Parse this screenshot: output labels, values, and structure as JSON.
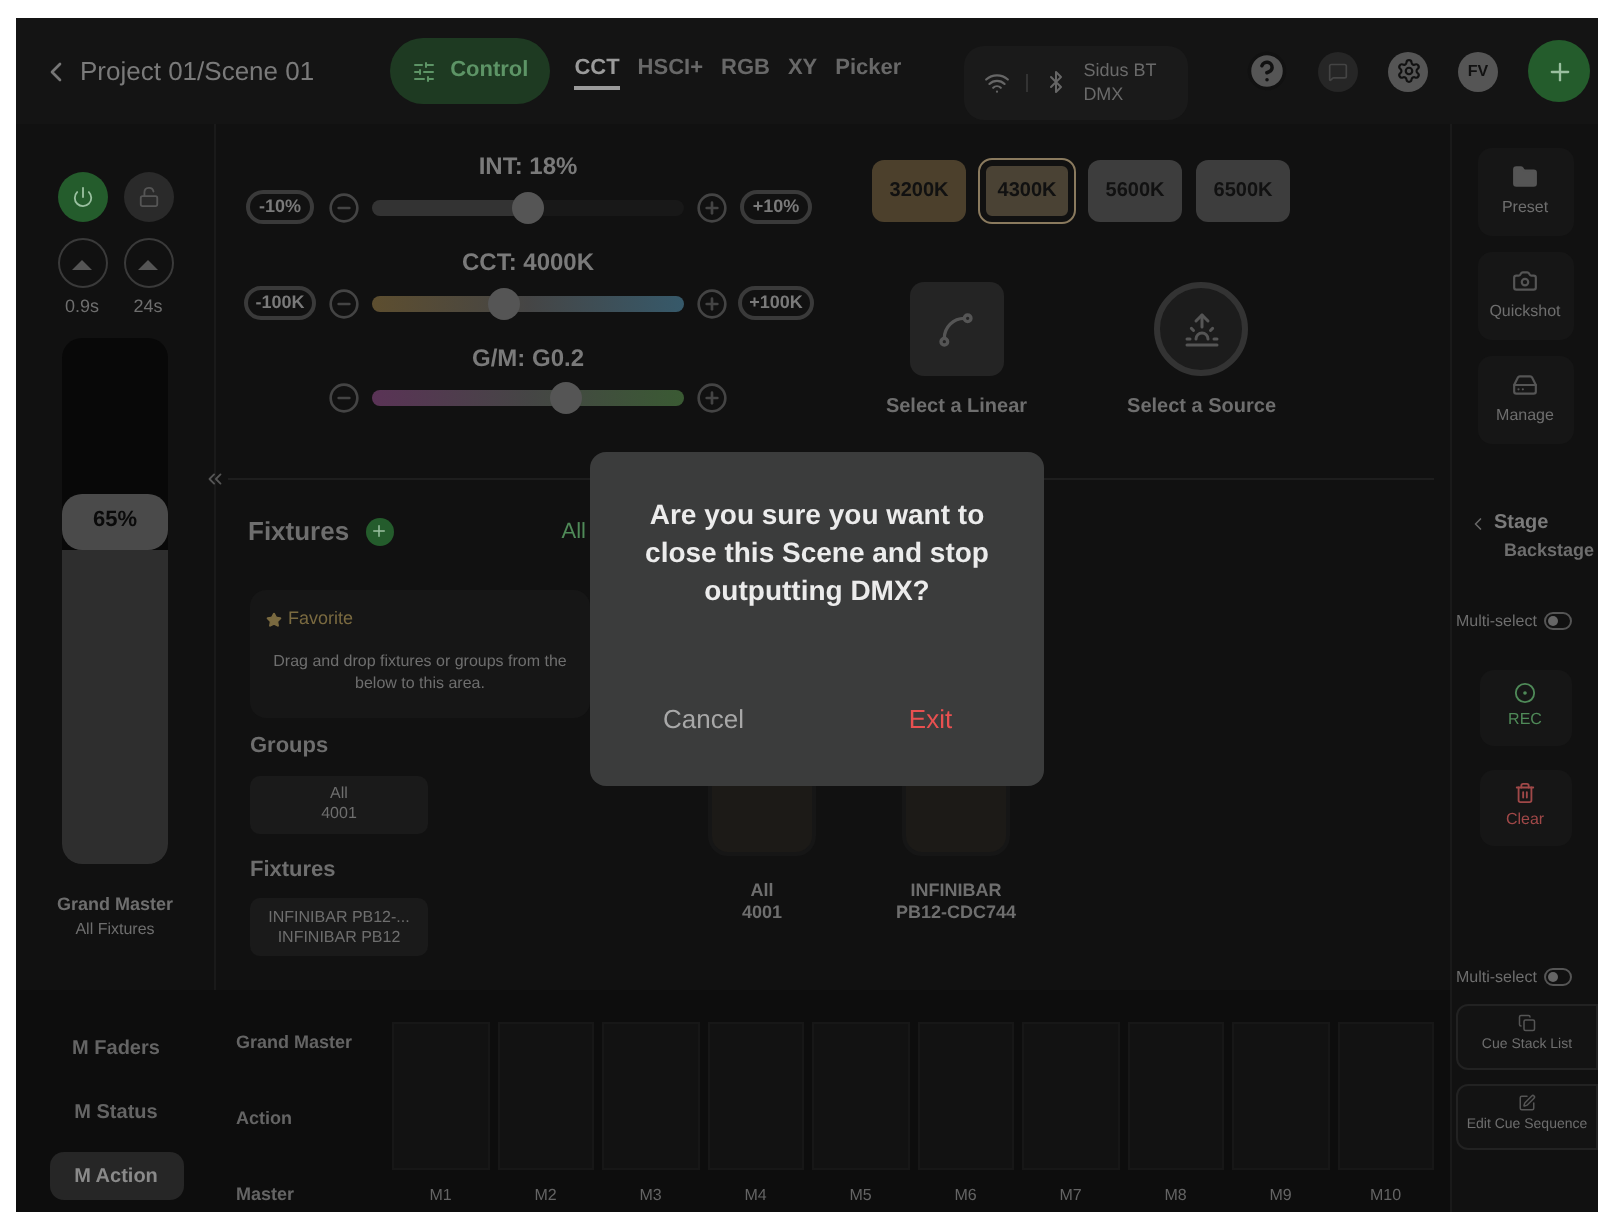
{
  "header": {
    "title": "Project 01/Scene 01",
    "mode_button": "Control",
    "tabs": [
      {
        "label": "CCT",
        "selected": true
      },
      {
        "label": "HSCI+",
        "selected": false
      },
      {
        "label": "RGB",
        "selected": false
      },
      {
        "label": "XY",
        "selected": false
      },
      {
        "label": "Picker",
        "selected": false
      }
    ],
    "connection": {
      "line1": "Sidus BT",
      "line2": "DMX"
    },
    "avatar": "FV"
  },
  "left_panel": {
    "power_on": true,
    "fade_in": "0.9s",
    "fade_out": "24s",
    "fader": {
      "level": 0.65,
      "reading": "65%",
      "label": "Grand Master",
      "sublabel": "All Fixtures"
    },
    "pages": [
      {
        "label": "M Faders",
        "selected": false
      },
      {
        "label": "M Status",
        "selected": false
      },
      {
        "label": "M Action",
        "selected": true
      }
    ]
  },
  "sliders": [
    {
      "kind": "int",
      "title": "INT: 18%",
      "minus_step": "-10%",
      "plus_step": "+10%",
      "level": 0.5
    },
    {
      "kind": "cct",
      "title": "CCT: 4000K",
      "minus_step": "-100K",
      "plus_step": "+100K",
      "level": 0.42
    },
    {
      "kind": "gm",
      "title": "G/M: G0.2",
      "level": 0.62
    }
  ],
  "presets": [
    {
      "label": "3200K",
      "selected": false,
      "color": "#4c402c"
    },
    {
      "label": "4300K",
      "selected": true,
      "color": "#4a4234"
    },
    {
      "label": "5600K",
      "selected": false,
      "color": "#3d3d3d"
    },
    {
      "label": "6500K",
      "selected": false,
      "color": "#3d3d3d"
    }
  ],
  "sources": [
    {
      "kind": "linear",
      "label": "Select a Linear"
    },
    {
      "kind": "source",
      "label": "Select a Source"
    }
  ],
  "fixtures_panel": {
    "title": "Fixtures",
    "filter": "All",
    "favorite": {
      "title": "Favorite",
      "hint_lines": [
        "Drag and drop fixtures or groups from the",
        "below to this area."
      ]
    },
    "groups_title": "Groups",
    "groups": [
      {
        "name": "All",
        "sub": "4001"
      }
    ],
    "fixtures_title": "Fixtures",
    "fixtures": [
      {
        "name": "INFINIBAR PB12-...",
        "sub": "INFINIBAR PB12"
      }
    ],
    "tiles": [
      {
        "name": "All",
        "sub": "4001"
      },
      {
        "name": "INFINIBAR",
        "sub": "PB12-CDC744"
      }
    ]
  },
  "masters": {
    "rows": [
      "Grand Master",
      "Action",
      "Master"
    ],
    "columns": [
      "M1",
      "M2",
      "M3",
      "M4",
      "M5",
      "M6",
      "M7",
      "M8",
      "M9",
      "M10"
    ]
  },
  "right_panel": {
    "tools": [
      {
        "kind": "preset",
        "label": "Preset"
      },
      {
        "kind": "quickshot",
        "label": "Quickshot"
      },
      {
        "kind": "manage",
        "label": "Manage"
      }
    ],
    "stage": {
      "title": "Stage",
      "subtitle": "Backstage"
    },
    "multi_select": {
      "label": "Multi-select",
      "on": false
    },
    "actions": [
      {
        "kind": "rec",
        "label": "REC"
      },
      {
        "kind": "clear",
        "label": "Clear"
      }
    ],
    "cue_multi_select": {
      "label": "Multi-select",
      "on": false
    },
    "cue_actions": [
      {
        "kind": "stack",
        "label": "Cue Stack List"
      },
      {
        "kind": "edit",
        "label": "Edit Cue Sequence"
      }
    ]
  },
  "dialog": {
    "message": "Are you sure you want to close this Scene and stop outputting DMX?",
    "cancel": "Cancel",
    "confirm": "Exit"
  }
}
